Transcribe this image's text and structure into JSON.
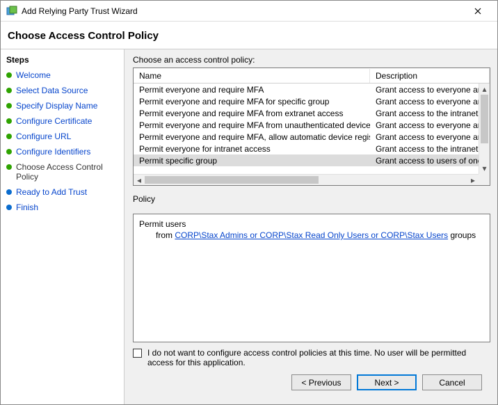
{
  "window": {
    "title": "Add Relying Party Trust Wizard"
  },
  "header": "Choose Access Control Policy",
  "steps_header": "Steps",
  "steps": [
    {
      "label": "Welcome",
      "status": "done"
    },
    {
      "label": "Select Data Source",
      "status": "done"
    },
    {
      "label": "Specify Display Name",
      "status": "done"
    },
    {
      "label": "Configure Certificate",
      "status": "done"
    },
    {
      "label": "Configure URL",
      "status": "done"
    },
    {
      "label": "Configure Identifiers",
      "status": "done"
    },
    {
      "label": "Choose Access Control Policy",
      "status": "current"
    },
    {
      "label": "Ready to Add Trust",
      "status": "todo"
    },
    {
      "label": "Finish",
      "status": "todo"
    }
  ],
  "list_label": "Choose an access control policy:",
  "columns": {
    "name": "Name",
    "description": "Description"
  },
  "policies": [
    {
      "name": "Permit everyone and require MFA",
      "description": "Grant access to everyone and requir",
      "selected": false
    },
    {
      "name": "Permit everyone and require MFA for specific group",
      "description": "Grant access to everyone and requir",
      "selected": false
    },
    {
      "name": "Permit everyone and require MFA from extranet access",
      "description": "Grant access to the intranet users an",
      "selected": false
    },
    {
      "name": "Permit everyone and require MFA from unauthenticated devices",
      "description": "Grant access to everyone and requir",
      "selected": false
    },
    {
      "name": "Permit everyone and require MFA, allow automatic device registr...",
      "description": "Grant access to everyone and requir",
      "selected": false
    },
    {
      "name": "Permit everyone for intranet access",
      "description": "Grant access to the intranet users.",
      "selected": false
    },
    {
      "name": "Permit specific group",
      "description": "Grant access to users of one or more",
      "selected": true
    }
  ],
  "policy_section_label": "Policy",
  "policy_detail": {
    "line1": "Permit users",
    "line2_prefix": "from ",
    "line2_link": "CORP\\Stax Admins or CORP\\Stax Read Only Users or CORP\\Stax Users",
    "line2_suffix": " groups"
  },
  "opt_out_label": "I do not want to configure access control policies at this time. No user will be permitted access for this application.",
  "buttons": {
    "previous": "< Previous",
    "next": "Next >",
    "cancel": "Cancel"
  }
}
